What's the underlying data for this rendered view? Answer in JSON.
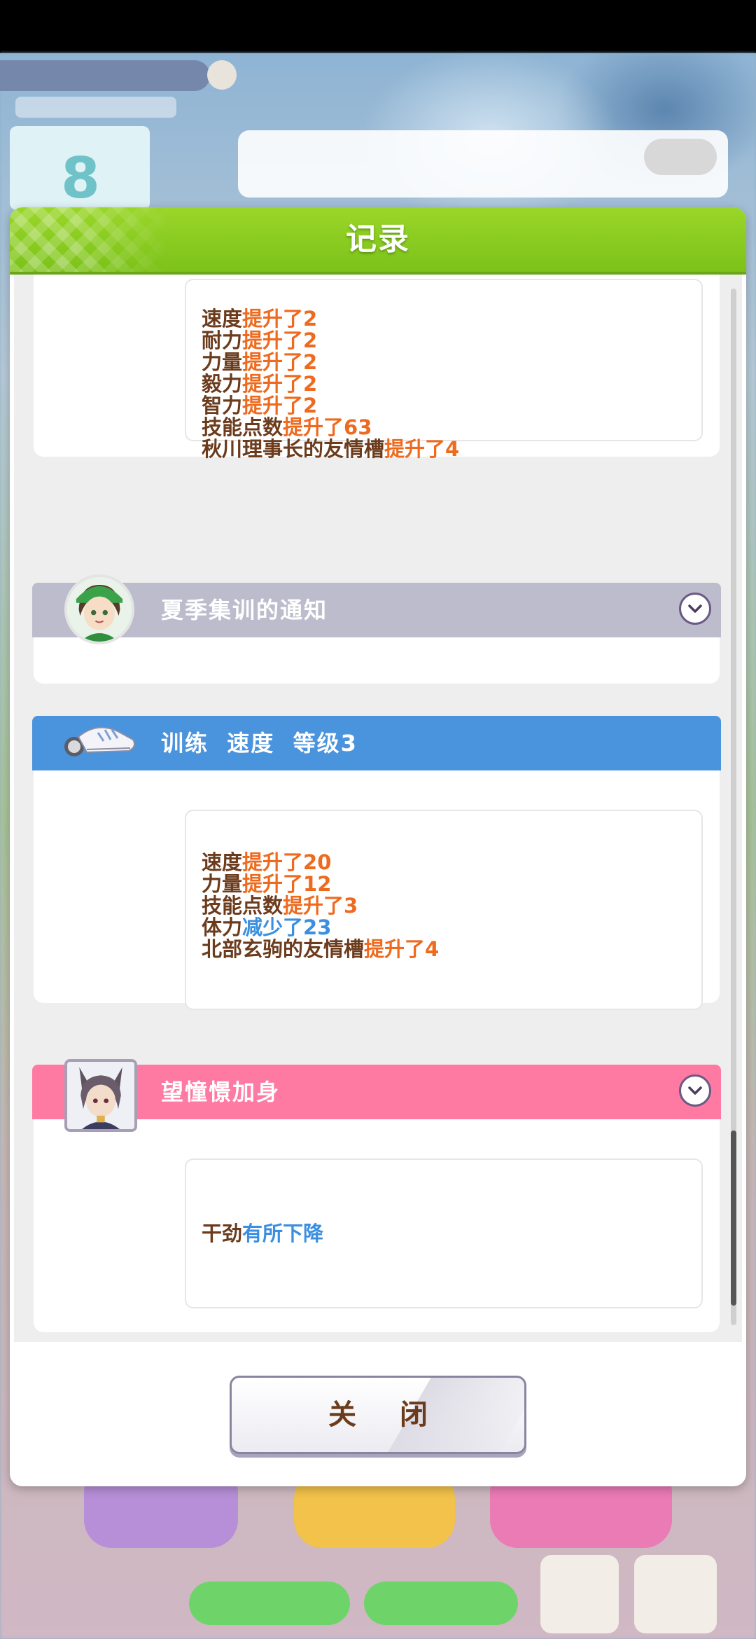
{
  "background": {
    "turn_number": "8"
  },
  "modal": {
    "title": "记录",
    "close_label": "关 闭"
  },
  "cards": [
    {
      "lines": [
        {
          "label": "速度",
          "change": "提升了2"
        },
        {
          "label": "耐力",
          "change": "提升了2"
        },
        {
          "label": "力量",
          "change": "提升了2"
        },
        {
          "label": "毅力",
          "change": "提升了2"
        },
        {
          "label": "智力",
          "change": "提升了2"
        },
        {
          "label": "技能点数",
          "change": "提升了63"
        },
        {
          "label": "秋川理事长的友情槽",
          "change": "提升了4"
        }
      ]
    },
    {
      "title": "夏季集训的通知",
      "header_color": "#bdbccc",
      "icon": "chevron-down-icon"
    },
    {
      "title": "训练  速度  等级3",
      "header_color": "#4a93dd",
      "icon": "training-shoes-icon",
      "lines": [
        {
          "label": "速度",
          "change": "提升了20"
        },
        {
          "label": "力量",
          "change": "提升了12"
        },
        {
          "label": "技能点数",
          "change": "提升了3"
        },
        {
          "label": "体力",
          "change": "减少了23"
        },
        {
          "label": "北部玄驹的友情槽",
          "change": "提升了4"
        }
      ]
    },
    {
      "title": "望憧憬加身",
      "header_color": "#ff7aa3",
      "icon": "chevron-down-icon",
      "lines": [
        {
          "label": "干劲",
          "change": "有所下降"
        }
      ]
    }
  ],
  "colors": {
    "increase": "#ee6a1e",
    "decrease": "#3a8fe0",
    "label_brown": "#6b3b1c",
    "header_green": "#8ccd22"
  }
}
